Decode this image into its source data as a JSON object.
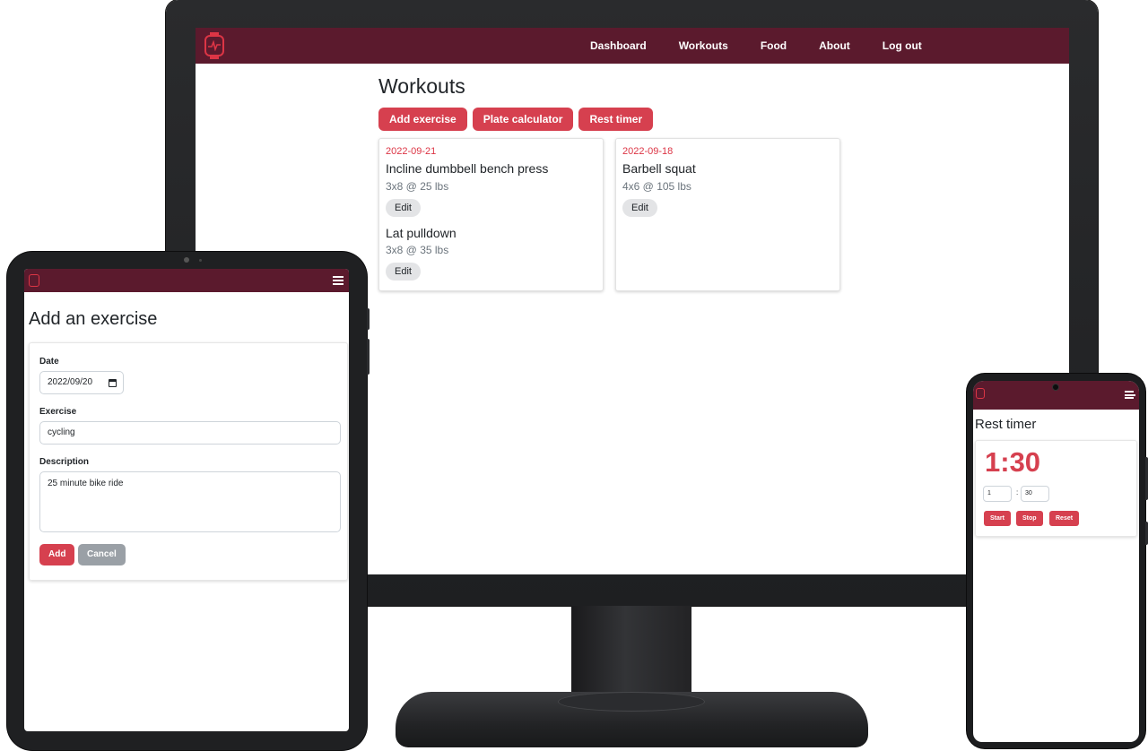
{
  "desktop": {
    "nav": [
      "Dashboard",
      "Workouts",
      "Food",
      "About",
      "Log out"
    ],
    "page_title": "Workouts",
    "buttons": [
      "Add exercise",
      "Plate calculator",
      "Rest timer"
    ],
    "cards": [
      {
        "date": "2022-09-21",
        "exercises": [
          {
            "name": "Incline dumbbell bench press",
            "desc": "3x8 @ 25 lbs",
            "edit": "Edit"
          },
          {
            "name": "Lat pulldown",
            "desc": "3x8 @ 35 lbs",
            "edit": "Edit"
          }
        ]
      },
      {
        "date": "2022-09-18",
        "exercises": [
          {
            "name": "Barbell squat",
            "desc": "4x6 @ 105 lbs",
            "edit": "Edit"
          }
        ]
      }
    ]
  },
  "tablet": {
    "title": "Add an exercise",
    "date_label": "Date",
    "date_value": "2022/09/20",
    "exercise_label": "Exercise",
    "exercise_value": "cycling",
    "description_label": "Description",
    "description_value": "25 minute bike ride",
    "add_label": "Add",
    "cancel_label": "Cancel"
  },
  "phone": {
    "title": "Rest timer",
    "time": "1:30",
    "minutes": "1",
    "colon": ":",
    "seconds": "30",
    "start_label": "Start",
    "stop_label": "Stop",
    "reset_label": "Reset"
  },
  "colors": {
    "nav": "#5b1a2d",
    "accent": "#d6404f",
    "date": "#dc3545",
    "secondary_button": "#9aa0a6",
    "edit_button": "#e3e4e6"
  },
  "icons": [
    "smartwatch-logo-icon",
    "hamburger-menu-icon",
    "calendar-icon"
  ]
}
